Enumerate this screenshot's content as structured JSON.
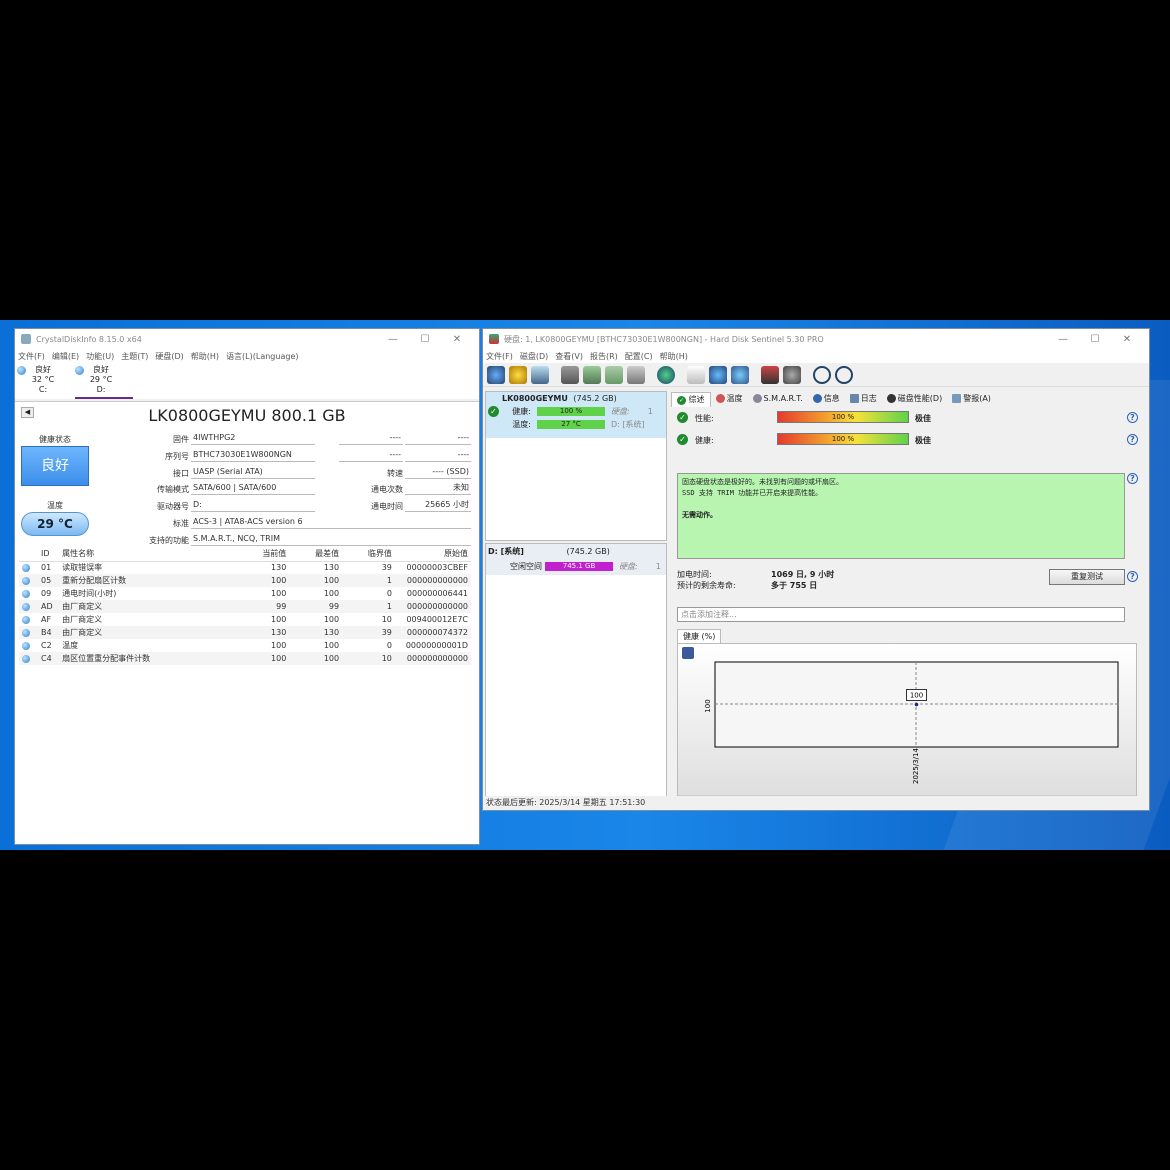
{
  "cdi": {
    "title": "CrystalDiskInfo 8.15.0 x64",
    "menu": [
      "文件(F)",
      "编辑(E)",
      "功能(U)",
      "主题(T)",
      "硬盘(D)",
      "帮助(H)",
      "语言(L)(Language)"
    ],
    "drives": [
      {
        "status": "良好",
        "temp": "32 °C",
        "letter": "C:"
      },
      {
        "status": "良好",
        "temp": "29 °C",
        "letter": "D:"
      }
    ],
    "model": "LK0800GEYMU 800.1 GB",
    "health_label": "健康状态",
    "health_value": "良好",
    "temp_label": "温度",
    "temp_value": "29 °C",
    "fields": {
      "firmware_label": "固件",
      "firmware": "4IWTHPG2",
      "serial_label": "序列号",
      "serial": "BTHC73030E1W800NGN",
      "interface_label": "接口",
      "interface": "UASP (Serial ATA)",
      "transfer_label": "传输模式",
      "transfer": "SATA/600 | SATA/600",
      "drive_label": "驱动器号",
      "drive": "D:",
      "standard_label": "标准",
      "standard": "ACS-3 | ATA8-ACS version 6",
      "features_label": "支持的功能",
      "features": "S.M.A.R.T., NCQ, TRIM",
      "r1a": "----",
      "r1b": "----",
      "r2a": "----",
      "r2b": "----",
      "rotation_label": "转速",
      "rotation": "---- (SSD)",
      "powercount_label": "通电次数",
      "powercount": "未知",
      "powerhours_label": "通电时间",
      "powerhours": "25665 小时"
    },
    "smart_headers": [
      "ID",
      "属性名称",
      "当前值",
      "最差值",
      "临界值",
      "原始值"
    ],
    "smart_rows": [
      [
        "01",
        "读取错误率",
        "130",
        "130",
        "39",
        "00000003CBEF"
      ],
      [
        "05",
        "重新分配扇区计数",
        "100",
        "100",
        "1",
        "000000000000"
      ],
      [
        "09",
        "通电时间(小时)",
        "100",
        "100",
        "0",
        "000000006441"
      ],
      [
        "AD",
        "由厂商定义",
        "99",
        "99",
        "1",
        "000000000000"
      ],
      [
        "AF",
        "由厂商定义",
        "100",
        "100",
        "10",
        "009400012E7C"
      ],
      [
        "B4",
        "由厂商定义",
        "130",
        "130",
        "39",
        "000000074372"
      ],
      [
        "C2",
        "温度",
        "100",
        "100",
        "0",
        "00000000001D"
      ],
      [
        "C4",
        "扇区位置重分配事件计数",
        "100",
        "100",
        "10",
        "000000000000"
      ]
    ]
  },
  "hds": {
    "title": "硬盘: 1, LK0800GEYMU [BTHC73030E1W800NGN] - Hard Disk Sentinel 5.30 PRO",
    "menu": [
      "文件(F)",
      "磁盘(D)",
      "查看(V)",
      "报告(R)",
      "配置(C)",
      "帮助(H)"
    ],
    "disk": {
      "name": "LK0800GEYMU",
      "size": "(745.2 GB)",
      "health_label": "健康:",
      "health": "100 %",
      "temp_label": "温度:",
      "temp": "27 °C",
      "disk_label": "硬盘:",
      "disk_num": "1",
      "drive": "D: [系统]"
    },
    "volume": {
      "name": "D: [系统]",
      "size": "(745.2 GB)",
      "free_label": "空闲空间",
      "free": "745.1 GB",
      "disk_label": "硬盘:",
      "disk_num": "1"
    },
    "tabs": [
      "综述",
      "温度",
      "S.M.A.R.T.",
      "信息",
      "日志",
      "磁盘性能(D)",
      "警报(A)"
    ],
    "perf_label": "性能:",
    "perf": "100 %",
    "perf_rating": "极佳",
    "health_label": "健康:",
    "health": "100 %",
    "health_rating": "极佳",
    "info_lines": [
      "固态硬盘状态是极好的。未找到有问题的或坏扇区。",
      "SSD 支持 TRIM 功能并已开启来提高性能。",
      "",
      "无需动作。"
    ],
    "poweron_label": "加电时间:",
    "poweron": "1069 日, 9 小时",
    "lifetime_label": "预计的剩余寿命:",
    "lifetime": "多于 755 日",
    "retest_label": "重复测试",
    "note_placeholder": "点击添加注释...",
    "chart_tab": "健康 (%)",
    "status_bar": "状态最后更新:   2025/3/14 星期五 17:51:30"
  },
  "chart_data": {
    "type": "line",
    "x": [
      "2025/3/14"
    ],
    "values": [
      100
    ],
    "ylabel": "100",
    "data_labels": [
      "100"
    ]
  },
  "colors": {
    "accent": "#3b8ee8",
    "info_bg": "#b8f5b0",
    "free_bar": "#c020d0",
    "desktop": "#1a86e8"
  }
}
